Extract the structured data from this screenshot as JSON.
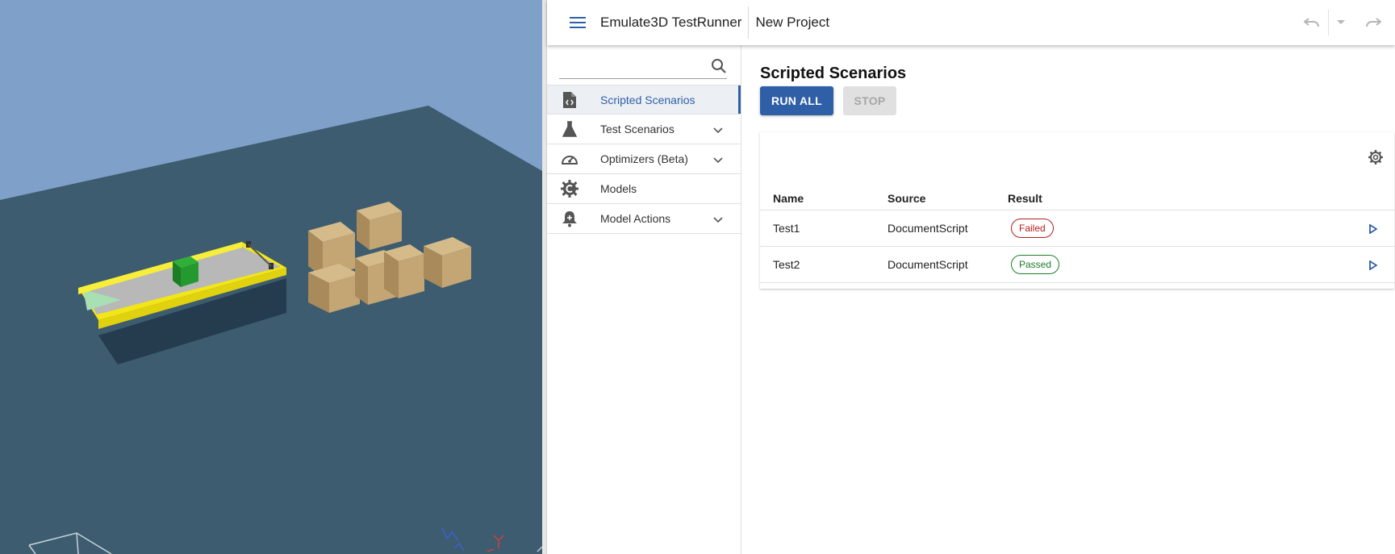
{
  "appbar": {
    "app_title": "Emulate3D TestRunner",
    "project_title": "New Project",
    "menu_icon": "menu-icon",
    "undo_icon": "undo-icon",
    "undo_menu_icon": "caret-down-icon",
    "redo_icon": "redo-icon"
  },
  "sidebar": {
    "search": {
      "value": "",
      "placeholder": ""
    },
    "items": [
      {
        "label": "Scripted Scenarios",
        "icon": "script-file-icon",
        "active": true,
        "expandable": false
      },
      {
        "label": "Test Scenarios",
        "icon": "flask-icon",
        "active": false,
        "expandable": true
      },
      {
        "label": "Optimizers (Beta)",
        "icon": "speedometer-icon",
        "active": false,
        "expandable": true
      },
      {
        "label": "Models",
        "icon": "model-gear-icon",
        "active": false,
        "expandable": false
      },
      {
        "label": "Model Actions",
        "icon": "bell-plus-icon",
        "active": false,
        "expandable": true
      }
    ]
  },
  "main": {
    "title": "Scripted Scenarios",
    "run_all_label": "RUN ALL",
    "stop_label": "STOP",
    "table": {
      "headers": [
        "Name",
        "Source",
        "Result"
      ],
      "rows": [
        {
          "name": "Test1",
          "source": "DocumentScript",
          "result": "Failed",
          "status": "failed"
        },
        {
          "name": "Test2",
          "source": "DocumentScript",
          "result": "Passed",
          "status": "passed"
        }
      ]
    }
  },
  "colors": {
    "accent": "#2f5fa7",
    "failed": "#b71c1c",
    "passed": "#1b7d2a",
    "sky": "#7fa0c8",
    "floor": "#3d5c70",
    "conveyor": "#f5e81c"
  }
}
